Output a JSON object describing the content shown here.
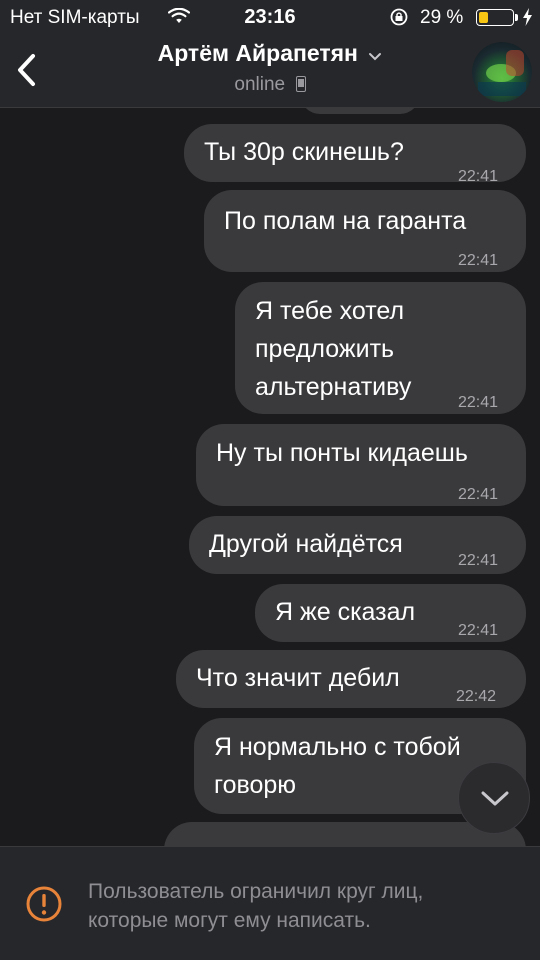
{
  "status_bar": {
    "carrier": "Нет SIM-карты",
    "time": "23:16",
    "battery_percent": "29 %",
    "battery_level": 0.29,
    "battery_color": "#f7c514"
  },
  "header": {
    "back_icon": "chevron-left-icon",
    "title": "Артём Айрапетян",
    "status": "online",
    "device_icon": "phone-icon"
  },
  "messages": [
    {
      "text": "Ты 30р скинешь?",
      "time": "22:41"
    },
    {
      "text": "По полам на гаранта",
      "time": "22:41"
    },
    {
      "text": "Я тебе хотел\nпредложить\nальтернативу",
      "time": "22:41"
    },
    {
      "text": "Ну ты понты кидаешь",
      "time": "22:41"
    },
    {
      "text": "Другой найдётся",
      "time": "22:41"
    },
    {
      "text": "Я же сказал",
      "time": "22:41"
    },
    {
      "text": "Что значит дебил",
      "time": "22:42"
    },
    {
      "text": "Я нормально с тобой\nговорю",
      "time": ""
    }
  ],
  "footer": {
    "notice": "Пользователь ограничил круг лиц,\nкоторые могут ему написать.",
    "icon": "warning-icon",
    "icon_color": "#e8833a"
  },
  "colors": {
    "bubble": "#3a3a3d",
    "background": "#1b1b1d",
    "bar": "#26272a"
  }
}
